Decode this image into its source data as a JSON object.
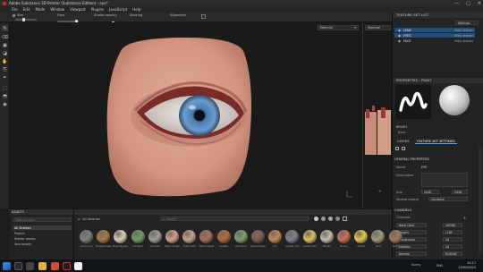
{
  "window": {
    "title": "Adobe Substance 3D Painter (Substance Edition) - eye*",
    "controls": [
      "—",
      "▢",
      "✕"
    ]
  },
  "menu": [
    "File",
    "Edit",
    "Mode",
    "Window",
    "Viewport",
    "Plugins",
    "JavaScript",
    "Help"
  ],
  "toolbar": {
    "size_label": "Size",
    "flow_label": "Flow",
    "stroke_opacity_label": "Stroke opacity",
    "spacing_label": "Spacing",
    "alignment_label": "Alignment"
  },
  "viewport": {
    "mode_main": "Material",
    "mode_side": "Material"
  },
  "texture_set_list": {
    "title": "TEXTURE SET LIST",
    "settings_label": "Settings",
    "items": [
      {
        "name": "LENS",
        "shader": "Main shader"
      },
      {
        "name": "EYES",
        "shader": "Main shader"
      },
      {
        "name": "FACE",
        "shader": "Main shader"
      }
    ]
  },
  "properties": {
    "title": "PROPERTIES - PAINT",
    "brush_label": "BRUSH",
    "brush_name": "Basic",
    "tabs": [
      "LAYERS",
      "TEXTURE SET SETTINGS"
    ],
    "general_title": "GENERAL PROPERTIES",
    "name_label": "Name",
    "name_value": "EYE",
    "description_label": "Description",
    "size_label": "Size",
    "size_value": "2048",
    "size_value2": "2048",
    "normal_mix_label": "Normal mixing",
    "normal_mix_value": "Combine",
    "channels_title": "CHANNELS",
    "channels_label": "Channels",
    "channel_rows": [
      {
        "name": "Base Color",
        "value": "sRGB8"
      },
      {
        "name": "Height",
        "value": "L16F"
      },
      {
        "name": "Roughness",
        "value": "L8"
      },
      {
        "name": "Metallic",
        "value": "L8"
      },
      {
        "name": "Normal",
        "value": "RGB16F"
      }
    ]
  },
  "shelf": {
    "title": "ASSETS",
    "filter_placeholder": "Filter by path",
    "categories": [
      "All Shelves",
      "Project",
      "Starter assets",
      "Your assets"
    ],
    "breadcrumb": "All libraries",
    "search_placeholder": "Search",
    "materials": [
      {
        "label": "Aluminium",
        "color": "#7d7e7d"
      },
      {
        "label": "Basket Grass",
        "color": "#a67a3e"
      },
      {
        "label": "Bone Stylized",
        "color": "#d9cdb0"
      },
      {
        "label": "Car Paint",
        "color": "#6f9e5f"
      },
      {
        "label": "Concrete",
        "color": "#9e9e96"
      },
      {
        "label": "Fabric Rough",
        "color": "#d7a08c"
      },
      {
        "label": "Fabric Soft",
        "color": "#caa189"
      },
      {
        "label": "Fabric Suede",
        "color": "#a96f55"
      },
      {
        "label": "Leather",
        "color": "#b4673a"
      },
      {
        "label": "Gold Pure",
        "color": "#7aa06b"
      },
      {
        "label": "Ground Grass",
        "color": "#7a5d4d"
      },
      {
        "label": "Iron",
        "color": "#c98357"
      },
      {
        "label": "Leather Old",
        "color": "#7b7f83"
      },
      {
        "label": "Leather Pad",
        "color": "#d7c25a"
      },
      {
        "label": "Marble",
        "color": "#bfbca8"
      },
      {
        "label": "Mosaic",
        "color": "#d26a56"
      },
      {
        "label": "Plastic",
        "color": "#e5c64a"
      },
      {
        "label": "Rock",
        "color": "#9b9a78"
      },
      {
        "label": "Wood",
        "color": "#9c7a52"
      }
    ]
  },
  "taskbar": {
    "time": "10:17",
    "date": "12/05/2023",
    "weather": "Sunny",
    "lang": "ENG"
  }
}
